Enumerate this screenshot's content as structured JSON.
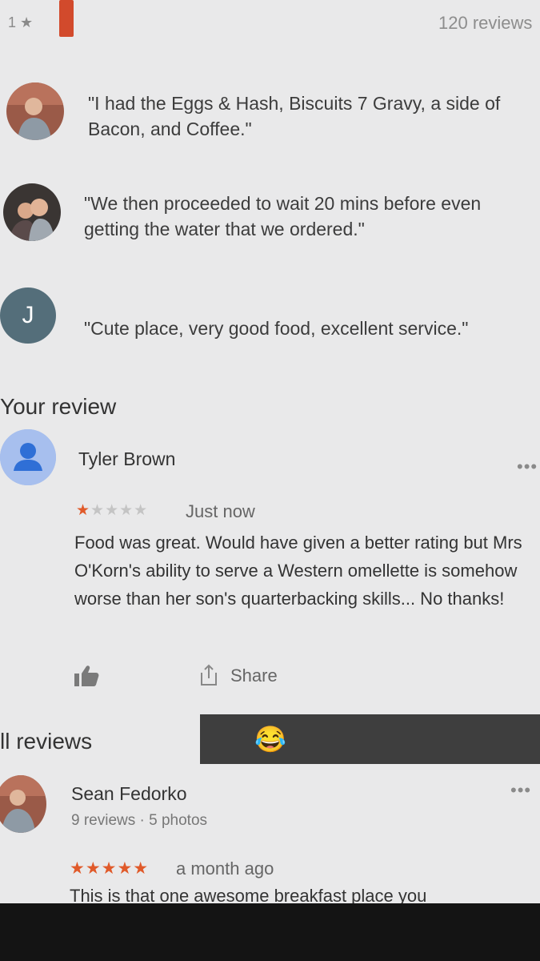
{
  "top": {
    "rating_label": "1 ★",
    "reviews_count": "120 reviews"
  },
  "snippets": [
    {
      "avatar": "photo-avatar",
      "quote": "\"I had the Eggs & Hash, Biscuits 7 Gravy, a side of Bacon, and Coffee.\""
    },
    {
      "avatar": "photo-avatar",
      "quote": "\"We then proceeded to wait 20 mins before even getting the water that we ordered.\""
    },
    {
      "avatar_letter": "J",
      "quote": "\"Cute place, very good food, excellent service.\""
    }
  ],
  "your_review": {
    "section_title": "Your review",
    "name": "Tyler Brown",
    "more": "•••",
    "rating": 1,
    "stars_filled": "★",
    "stars_empty": "★★★★",
    "time": "Just now",
    "text": "Food was great. Would have given a better rating but Mrs O'Korn's ability to serve a Western omellette is somehow worse than her son's quarterbacking skills... No thanks!",
    "share_label": "Share"
  },
  "all_reviews": {
    "section_title": "ll reviews",
    "emoji": "😂"
  },
  "reviews": [
    {
      "name": "Sean Fedorko",
      "meta": "9 reviews · 5 photos",
      "more": "•••",
      "rating": 5,
      "stars": "★★★★★",
      "time": "a month ago",
      "text": "This is that one awesome breakfast place you"
    }
  ],
  "colors": {
    "accent_star": "#e05a2a",
    "rating_bar": "#d24a2c",
    "letter_avatar": "#546e7a",
    "dark_bar": "#3e3e3e"
  }
}
